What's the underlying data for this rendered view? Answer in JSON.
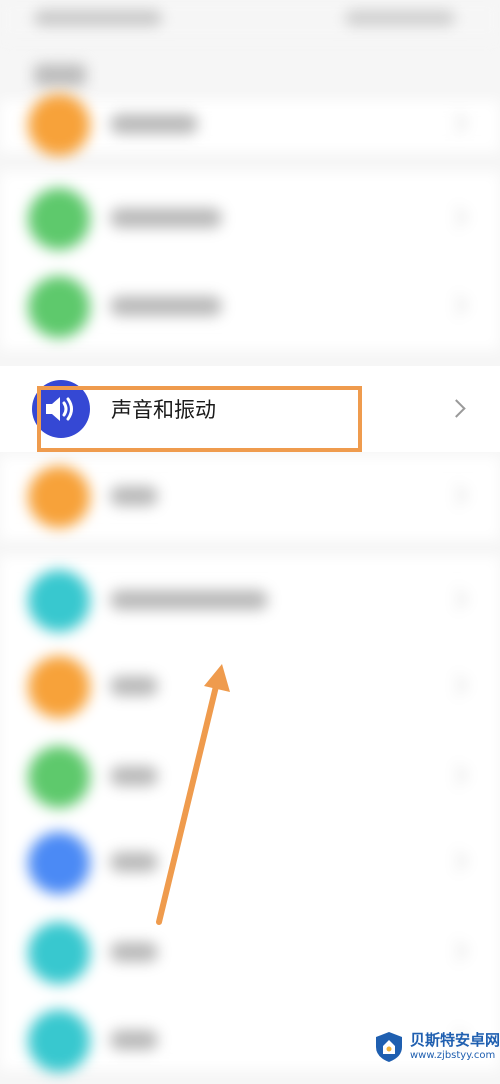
{
  "sound_row": {
    "label": "声音和振动",
    "icon": "speaker-icon",
    "icon_color": "#3548d4"
  },
  "annotation": {
    "highlight_color": "#ef9b4d",
    "arrow_color": "#ef9b4d"
  },
  "blurred_icon_colors": [
    "#f7a23a",
    "#5ec96c",
    "#5ec96c",
    "#f7a23a",
    "#38c8cf",
    "#f7a23a",
    "#5ec96c",
    "#4b8af5",
    "#38c8cf",
    "#38c8cf"
  ],
  "watermark": {
    "title": "贝斯特安卓网",
    "url": "www.zjbstyy.com",
    "color": "#1f5fb0"
  }
}
